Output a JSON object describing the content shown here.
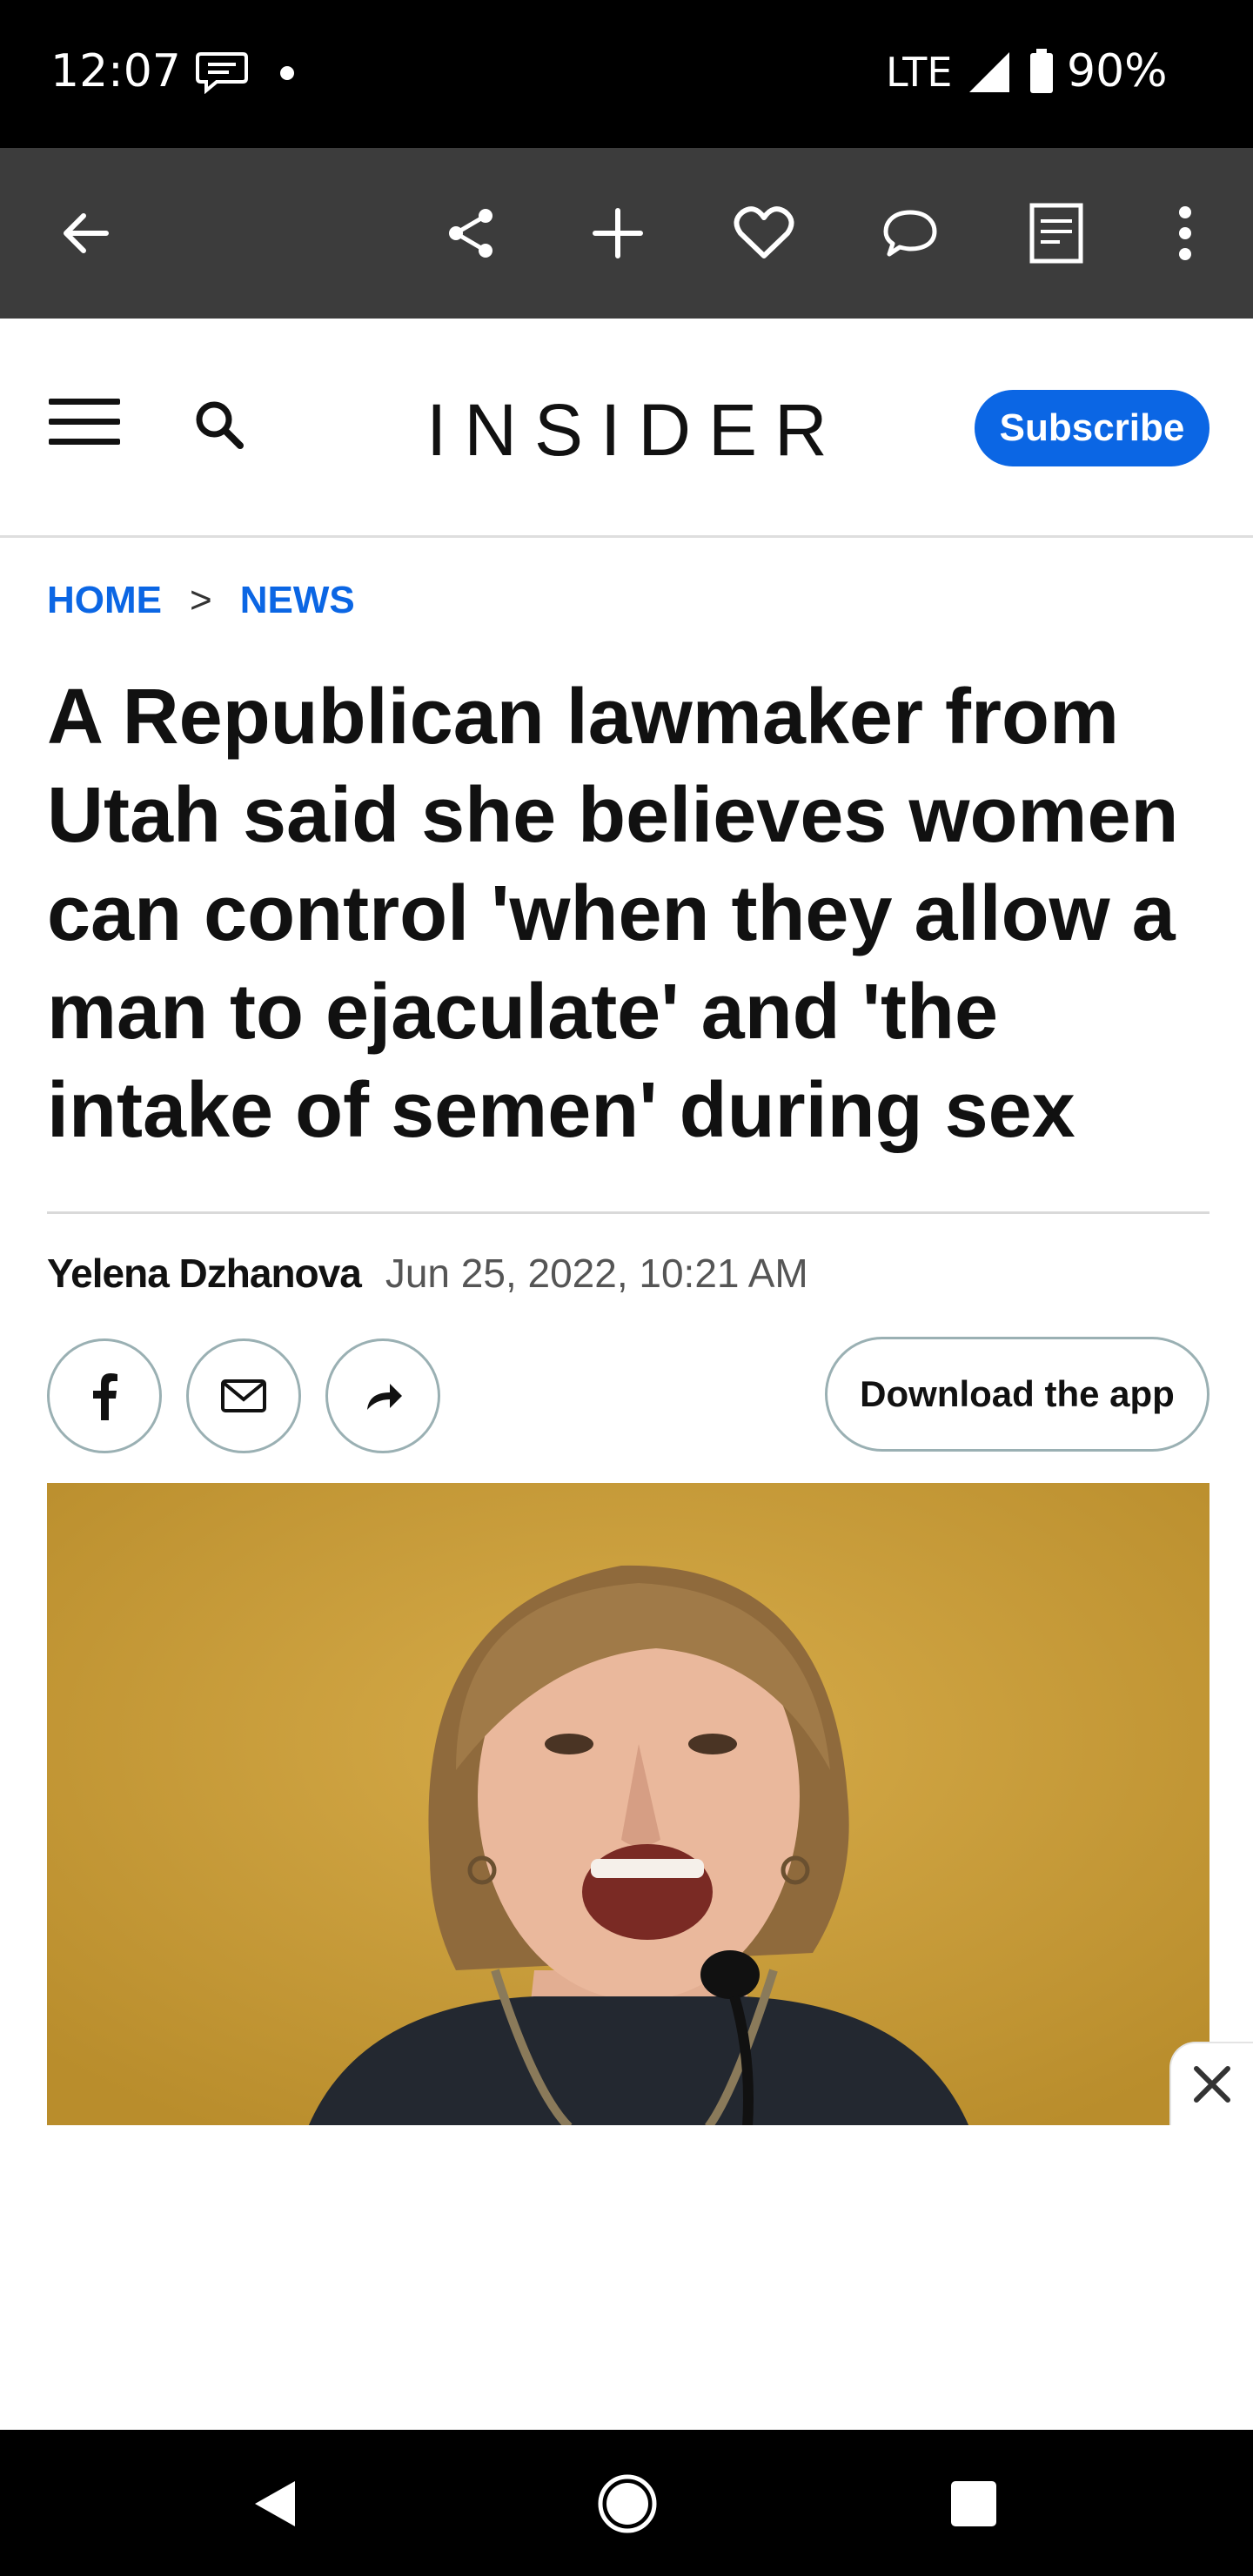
{
  "status_bar": {
    "time": "12:07",
    "network": "LTE",
    "battery": "90%",
    "icons": [
      "message-icon",
      "notification-dot",
      "signal-icon",
      "battery-icon"
    ]
  },
  "browser_toolbar": {
    "icons": [
      "back-arrow-icon",
      "share-icon",
      "plus-icon",
      "heart-icon",
      "comment-icon",
      "reader-icon",
      "more-vert-icon"
    ]
  },
  "site_header": {
    "logo": "INSIDER",
    "subscribe_label": "Subscribe",
    "brand_color": "#0b66e4",
    "icons": [
      "hamburger-menu-icon",
      "search-icon"
    ]
  },
  "breadcrumb": {
    "items": [
      "HOME",
      "NEWS"
    ],
    "separator": ">"
  },
  "article": {
    "headline": "A Republican lawmaker from Utah said she believes women can control 'when they allow a man to ejaculate' and 'the intake of semen' during sex",
    "author": "Yelena Dzhanova",
    "date": "Jun 25, 2022, 10:21 AM"
  },
  "share": {
    "icons": [
      "facebook-icon",
      "email-icon",
      "share-arrow-icon"
    ],
    "download_label": "Download the app"
  },
  "ad": {
    "close_icon": "close-icon"
  },
  "nav_bar": {
    "icons": [
      "back-triangle-icon",
      "home-circle-icon",
      "recents-square-icon"
    ]
  }
}
